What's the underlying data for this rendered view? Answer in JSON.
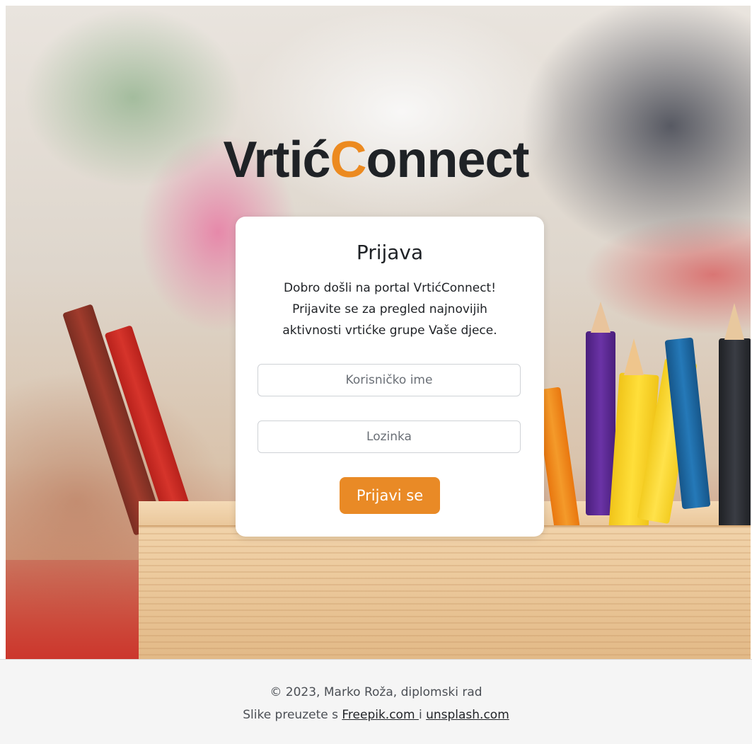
{
  "brand": {
    "name_prefix": "Vrtić",
    "name_accent": "C",
    "name_suffix": "onnect",
    "accent_color": "#ec8a20"
  },
  "login": {
    "title": "Prijava",
    "welcome_line1": "Dobro došli na portal VrtićConnect!",
    "welcome_line2": "Prijavite se za pregled najnovijih",
    "welcome_line3": "aktivnosti vrtićke grupe Vaše djece.",
    "username_placeholder": "Korisničko ime",
    "password_placeholder": "Lozinka",
    "submit_label": "Prijavi se",
    "button_color": "#e98a26"
  },
  "footer": {
    "copyright": "© 2023, Marko Roža, diplomski rad",
    "credits_prefix": "Slike preuzete s ",
    "link1_label": "Freepik.com ",
    "credits_mid": "i ",
    "link2_label": "unsplash.com"
  }
}
